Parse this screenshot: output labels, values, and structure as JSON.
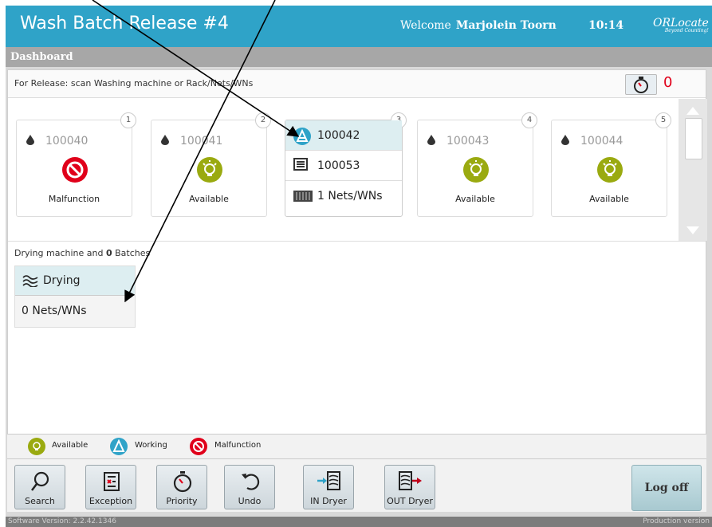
{
  "header": {
    "title": "Wash Batch Release #4",
    "welcome_label": "Welcome",
    "user_name": "Marjolein Toorn",
    "time": "10:14",
    "logo": "ORLocate",
    "logo_tagline": "Beyond Counting!"
  },
  "tab": {
    "label": "Dashboard"
  },
  "release": {
    "instruction": "For Release: scan Washing machine or Rack/Nets/WNs",
    "priority_count": "0"
  },
  "machines": [
    {
      "badge": "1",
      "id": "100040",
      "status": "Malfunction"
    },
    {
      "badge": "2",
      "id": "100041",
      "status": "Available"
    },
    {
      "badge": "3",
      "id": "100042",
      "batch": "100053",
      "nets": "1 Nets/WNs"
    },
    {
      "badge": "4",
      "id": "100043",
      "status": "Available"
    },
    {
      "badge": "5",
      "id": "100044",
      "status": "Available"
    }
  ],
  "drying": {
    "label_prefix": "Drying machine and",
    "batch_count": "0",
    "label_suffix": "Batches",
    "card_title": "Drying",
    "nets": "0 Nets/WNs"
  },
  "legend": {
    "available": "Available",
    "working": "Working",
    "malfunction": "Malfunction"
  },
  "toolbar": {
    "search": "Search",
    "exception": "Exception",
    "priority": "Priority",
    "undo": "Undo",
    "in_dryer": "IN Dryer",
    "out_dryer": "OUT Dryer",
    "logoff": "Log off"
  },
  "footer": {
    "version": "Software Version: 2.2.42.1346",
    "environment": "Production version"
  },
  "colors": {
    "header": "#2fa3c8",
    "available": "#9aaa10",
    "working": "#2fa3c8",
    "malfunction": "#e0001a"
  }
}
